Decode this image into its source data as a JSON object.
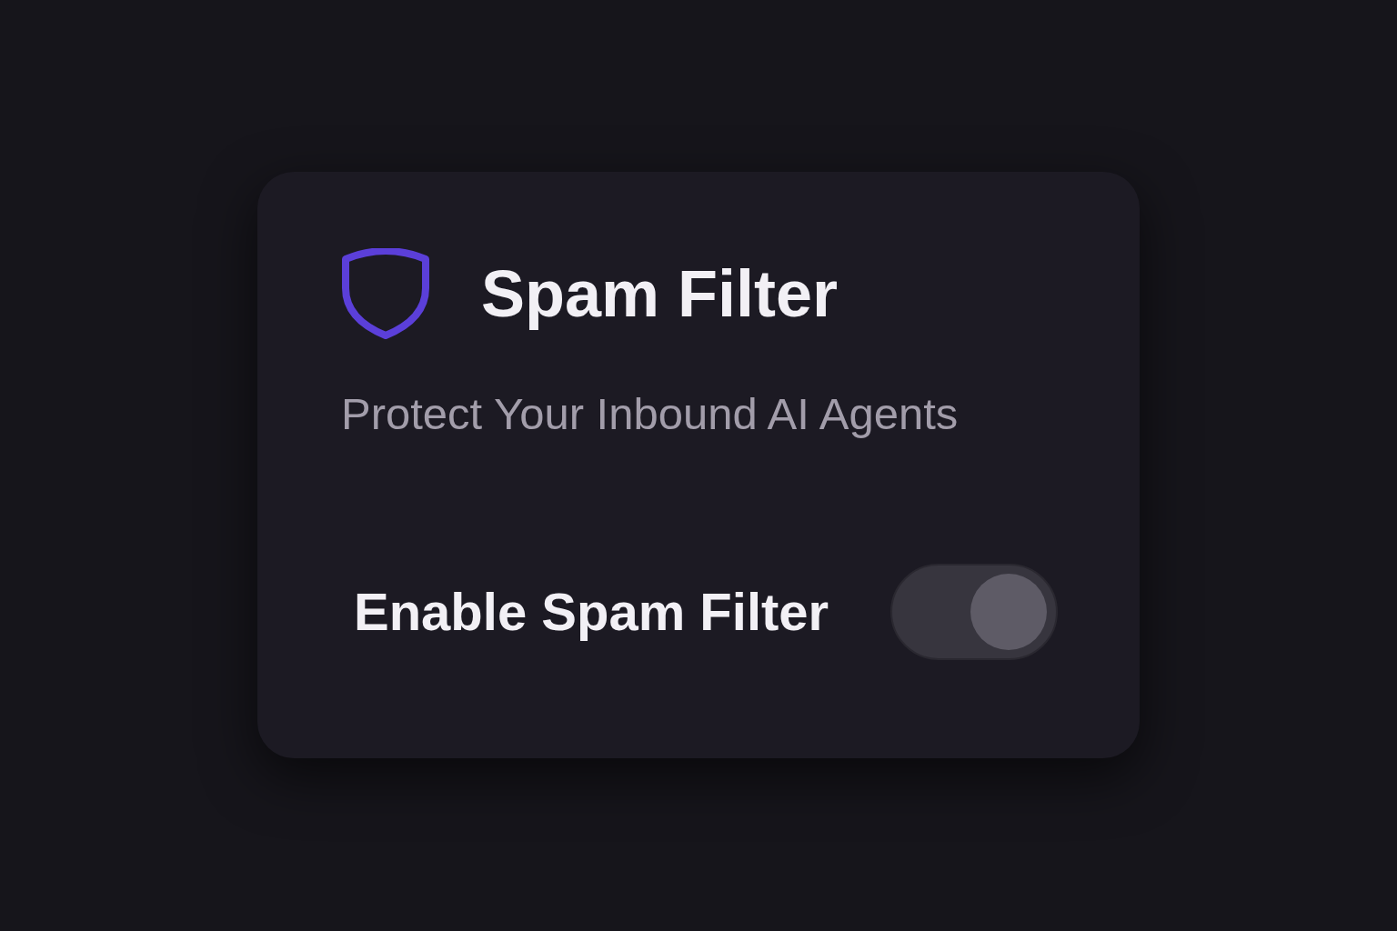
{
  "card": {
    "title": "Spam Filter",
    "subtitle": "Protect Your Inbound AI Agents"
  },
  "setting": {
    "label": "Enable Spam Filter",
    "on": true
  }
}
